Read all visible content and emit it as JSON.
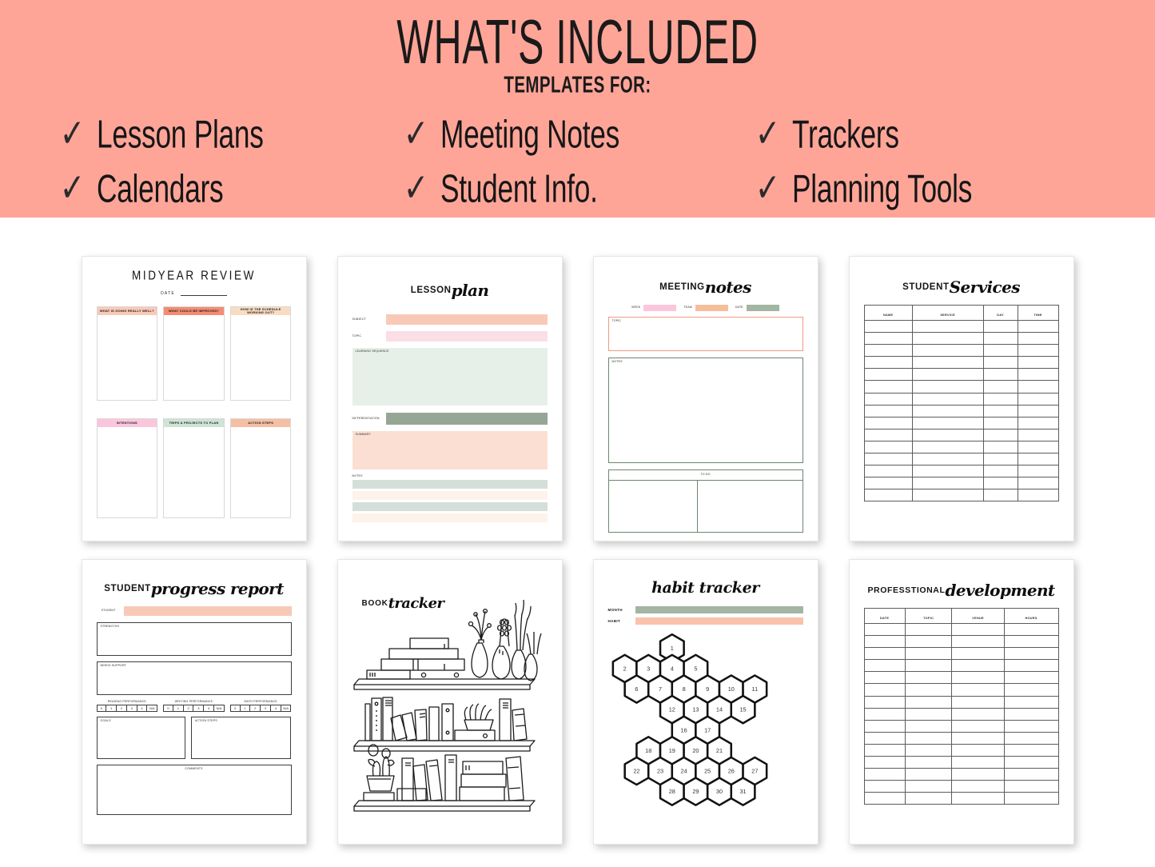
{
  "banner": {
    "title": "WHAT'S INCLUDED",
    "subtitle": "TEMPLATES FOR:",
    "check_glyph": "✓",
    "items": [
      "Lesson Plans",
      "Meeting Notes",
      "Trackers",
      "Calendars",
      "Student Info.",
      "Planning Tools"
    ],
    "bg_color": "#FFA598"
  },
  "colors": {
    "peach": "#F9C9B8",
    "coral": "#F48C72",
    "light_peach": "#FADCC2",
    "pink": "#FBC6DC",
    "light_pink": "#FBDEE6",
    "mint": "#CFE4D4",
    "mint_light": "#E6F0E8",
    "sage": "#96A695",
    "sage_soft": "#A3B5A3",
    "sage_gray": "#D4DFDA",
    "cream": "#FDF3EA",
    "salmon_band": "#F6BFA4",
    "border_gray": "#5c5c5c"
  },
  "pages": {
    "midyear_review": {
      "title": "MIDYEAR REVIEW",
      "date_label": "DATE",
      "row1": [
        {
          "label": "WHAT IS GOING REALLY WELL?",
          "color": "#F9C9B8"
        },
        {
          "label": "WHAT COULD BE IMPROVED?",
          "color": "#F48C72"
        },
        {
          "label": "HOW IS THE SCHEDULE WORKING OUT?",
          "color": "#FADCC2"
        }
      ],
      "row2": [
        {
          "label": "INTENTIONS",
          "color": "#FBC6DC"
        },
        {
          "label": "TRIPS & PROJECTS TO PLAN",
          "color": "#CFE4D4"
        },
        {
          "label": "ACTION STEPS",
          "color": "#F6BFA4"
        }
      ]
    },
    "lesson_plan": {
      "title_block": "LESSON",
      "title_script": "plan",
      "fields": [
        {
          "label": "SUBJECT",
          "type": "bar",
          "color": "#F9C9B8",
          "height": 13
        },
        {
          "label": "TOPIC",
          "type": "bar",
          "color": "#FBDEE6",
          "height": 13
        }
      ],
      "learning_sequence": {
        "label": "LEARNING SEQUENCE",
        "color": "#E6F0E8",
        "height": 72
      },
      "differentiation": {
        "label": "DIFFERENTIATION",
        "color": "#96A695",
        "height": 15
      },
      "summary": {
        "label": "SUMMARY",
        "color": "#FBDFD3",
        "height": 48
      },
      "notes_label": "NOTES",
      "notes_stripes": [
        "#D4DFDA",
        "#FDF3EA",
        "#D4DFDA",
        "#FDF3EA"
      ]
    },
    "meeting_notes": {
      "title_block": "MEETING",
      "title_script": "notes",
      "fields": [
        {
          "label": "WEEK",
          "color": "#FBC6DC"
        },
        {
          "label": "TEAM",
          "color": "#F5BE9B"
        },
        {
          "label": "DATE",
          "color": "#A3B5A3"
        }
      ],
      "topic_label": "TOPIC",
      "topic_border": "#F09A7E",
      "notes_label": "NOTES",
      "notes_border": "#6E8570",
      "todo_label": "TO DO"
    },
    "student_services": {
      "title_block": "STUDENT",
      "title_script": "Services",
      "columns": [
        "NAME",
        "SERVICE",
        "DAY",
        "TIME"
      ],
      "row_count": 15
    },
    "progress_report": {
      "title_block": "STUDENT",
      "title_script": "progress report",
      "student_label": "STUDENT",
      "strengths_label": "STRENGTHS",
      "needs_support_label": "NEEDS SUPPORT",
      "scales": [
        {
          "label": "READING PERFORMANCE",
          "cells": [
            "0",
            "1",
            "2",
            "3",
            "4",
            "N/A"
          ]
        },
        {
          "label": "WRITING PERFORMANCE",
          "cells": [
            "0",
            "1",
            "2",
            "3",
            "4",
            "N/A"
          ]
        },
        {
          "label": "MATH PERFORMANCE",
          "cells": [
            "0",
            "1",
            "2",
            "3",
            "4",
            "N/A"
          ]
        }
      ],
      "goals_label": "GOALS",
      "action_steps_label": "ACTION STEPS",
      "comments_label": "COMMENTS"
    },
    "book_tracker": {
      "title_block": "BOOK",
      "title_script": "tracker",
      "illustration": "bookshelf-line-art"
    },
    "habit_tracker": {
      "title_script": "habit tracker",
      "fields": [
        {
          "label": "MONTH",
          "color": "#A3B5A3"
        },
        {
          "label": "HABIT",
          "color": "#F9C3AB"
        }
      ],
      "hex_rows": [
        {
          "offset": 2.0,
          "numbers": [
            "1"
          ]
        },
        {
          "offset": 0.0,
          "numbers": [
            "2",
            "3",
            "4",
            "5"
          ]
        },
        {
          "offset": 0.5,
          "numbers": [
            "6",
            "7",
            "8",
            "9",
            "10",
            "11"
          ]
        },
        {
          "offset": 2.0,
          "numbers": [
            "12",
            "13",
            "14",
            "15"
          ]
        },
        {
          "offset": 2.5,
          "numbers": [
            "16",
            "17"
          ]
        },
        {
          "offset": 1.0,
          "numbers": [
            "18",
            "19",
            "20",
            "21"
          ]
        },
        {
          "offset": 0.5,
          "numbers": [
            "22",
            "23",
            "24",
            "25",
            "26",
            "27"
          ]
        },
        {
          "offset": 2.0,
          "numbers": [
            "28",
            "29",
            "30",
            "31"
          ]
        }
      ]
    },
    "professional_development": {
      "title_block": "PROFESSTIONAL",
      "title_script": "development",
      "columns": [
        "DATE",
        "TOPIC",
        "VENUE",
        "HOURS"
      ],
      "row_count": 15
    }
  }
}
